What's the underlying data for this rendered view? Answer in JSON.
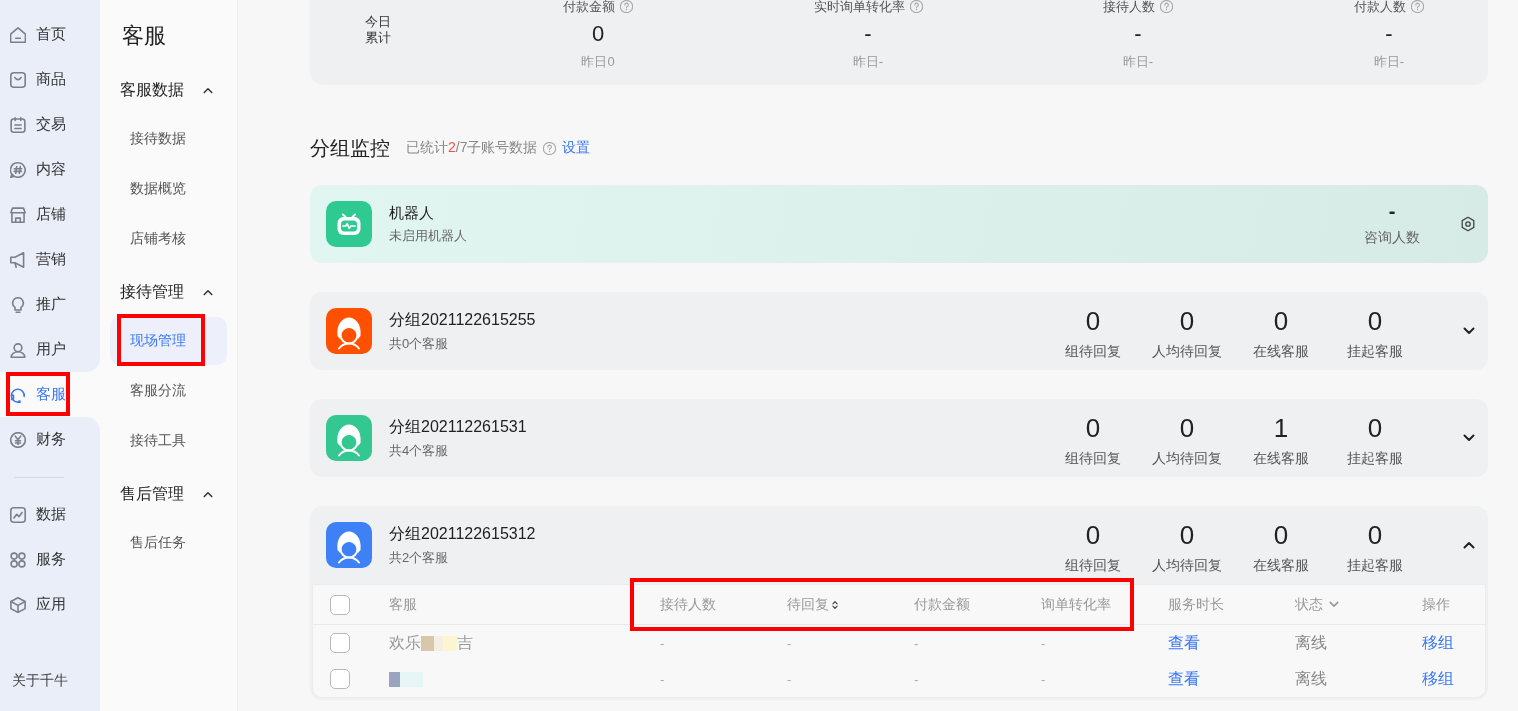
{
  "nav": {
    "sections": [
      {
        "items": [
          {
            "label": "首页",
            "selected": false,
            "highlighted": false
          },
          {
            "label": "商品",
            "selected": false,
            "highlighted": false
          },
          {
            "label": "交易",
            "selected": false,
            "highlighted": false
          },
          {
            "label": "内容",
            "selected": false,
            "highlighted": false
          },
          {
            "label": "店铺",
            "selected": false,
            "highlighted": false
          },
          {
            "label": "营销",
            "selected": false,
            "highlighted": false
          },
          {
            "label": "推广",
            "selected": false,
            "highlighted": false
          },
          {
            "label": "用户",
            "selected": false,
            "highlighted": false
          },
          {
            "label": "客服",
            "selected": true,
            "highlighted": true
          },
          {
            "label": "财务",
            "selected": false,
            "highlighted": false
          }
        ]
      },
      {
        "items": [
          {
            "label": "数据",
            "selected": false,
            "highlighted": false
          },
          {
            "label": "服务",
            "selected": false,
            "highlighted": false
          },
          {
            "label": "应用",
            "selected": false,
            "highlighted": false
          }
        ]
      }
    ],
    "footer": "关于千牛"
  },
  "submenu": {
    "title": "客服",
    "sections": [
      {
        "title": "客服数据",
        "expanded": true,
        "items": [
          {
            "label": "接待数据",
            "selected": false,
            "highlighted": false
          },
          {
            "label": "数据概览",
            "selected": false,
            "highlighted": false
          },
          {
            "label": "店铺考核",
            "selected": false,
            "highlighted": false
          }
        ]
      },
      {
        "title": "接待管理",
        "expanded": true,
        "items": [
          {
            "label": "现场管理",
            "selected": true,
            "highlighted": true
          },
          {
            "label": "客服分流",
            "selected": false,
            "highlighted": false
          },
          {
            "label": "接待工具",
            "selected": false,
            "highlighted": false
          }
        ]
      },
      {
        "title": "售后管理",
        "expanded": true,
        "items": [
          {
            "label": "售后任务",
            "selected": false,
            "highlighted": false
          }
        ]
      }
    ]
  },
  "summary": {
    "row_label": "今日累计",
    "metrics": [
      {
        "label": "付款金额",
        "value": "0",
        "yesterday": "昨日0"
      },
      {
        "label": "实时询单转化率",
        "value": "-",
        "yesterday": "昨日-"
      },
      {
        "label": "接待人数",
        "value": "-",
        "yesterday": "昨日-"
      },
      {
        "label": "付款人数",
        "value": "-",
        "yesterday": "昨日-"
      }
    ]
  },
  "monitor": {
    "title": "分组监控",
    "counted_prefix": "已统计",
    "counted": "2",
    "counted_suffix": "/7子账号数据",
    "settings_link": "设置"
  },
  "robot": {
    "name": "机器人",
    "status": "未启用机器人",
    "value": "-",
    "value_label": "咨询人数"
  },
  "groups": [
    {
      "name": "分组2021122615255",
      "member_count": "共0个客服",
      "color": "#ff5000",
      "expanded": false,
      "stats": [
        {
          "value": "0",
          "label": "组待回复"
        },
        {
          "value": "0",
          "label": "人均待回复"
        },
        {
          "value": "0",
          "label": "在线客服"
        },
        {
          "value": "0",
          "label": "挂起客服"
        }
      ]
    },
    {
      "name": "分组202112261531",
      "member_count": "共4个客服",
      "color": "#33c792",
      "expanded": false,
      "stats": [
        {
          "value": "0",
          "label": "组待回复"
        },
        {
          "value": "0",
          "label": "人均待回复"
        },
        {
          "value": "1",
          "label": "在线客服"
        },
        {
          "value": "0",
          "label": "挂起客服"
        }
      ]
    },
    {
      "name": "分组2021122615312",
      "member_count": "共2个客服",
      "color": "#3e80f6",
      "expanded": true,
      "stats": [
        {
          "value": "0",
          "label": "组待回复"
        },
        {
          "value": "0",
          "label": "人均待回复"
        },
        {
          "value": "0",
          "label": "在线客服"
        },
        {
          "value": "0",
          "label": "挂起客服"
        }
      ],
      "table": {
        "select_all_checked": false,
        "columns": [
          {
            "label": "客服",
            "kind": "plain",
            "highlighted": false
          },
          {
            "label": "接待人数",
            "kind": "plain",
            "highlighted": true
          },
          {
            "label": "待回复",
            "kind": "sort",
            "highlighted": true
          },
          {
            "label": "付款金额",
            "kind": "plain",
            "highlighted": true
          },
          {
            "label": "询单转化率",
            "kind": "plain",
            "highlighted": true
          },
          {
            "label": "服务时长",
            "kind": "plain",
            "highlighted": false
          },
          {
            "label": "状态",
            "kind": "filter",
            "highlighted": false
          },
          {
            "label": "操作",
            "kind": "plain",
            "highlighted": false
          }
        ],
        "rows": [
          {
            "checked": false,
            "name_parts": [
              "欢乐",
              "吉"
            ],
            "redacted": true,
            "values": [
              "-",
              "-",
              "-",
              "-"
            ],
            "duration": "查看",
            "status": "离线",
            "action": "移组"
          },
          {
            "checked": false,
            "redacted": true,
            "values": [
              "-",
              "-",
              "-",
              "-"
            ],
            "duration": "查看",
            "status": "离线",
            "action": "移组"
          }
        ]
      }
    }
  ]
}
